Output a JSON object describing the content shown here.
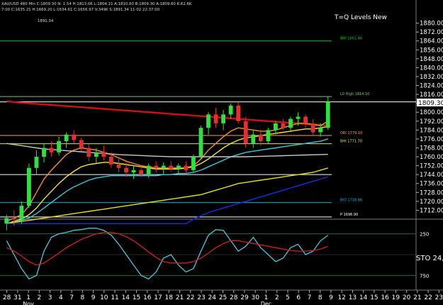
{
  "header": {
    "line1": "XAU/USD 480 Min  C:1809.30  N: 1.54  H:1813.06  L:1804.21  A:1810.60  B:1809.30  A:1809.60  K:62.6K",
    "line2": "7:00  C:1635.21  H:1669.20  L:1634.61  C:1656.97  V:349K  S:1891.34  11-02 22:37:00",
    "prior_high": "1891.34"
  },
  "chart_data": [
    {
      "type": "line",
      "title": "T=Q Levels New",
      "title_suffix": "STO",
      "price_axis": {
        "ylim": [
          1704,
          1888
        ],
        "ticks": [
          1712,
          1720,
          1728,
          1736,
          1744,
          1752,
          1760,
          1768,
          1776,
          1784,
          1792,
          1800,
          1808,
          1816,
          1824,
          1832,
          1840,
          1848,
          1856,
          1864,
          1872,
          1880
        ],
        "tick_labels": [
          "1712.00",
          "1720.00",
          "1728.00",
          "1736.00",
          "1744.00",
          "1752.00",
          "1760.00",
          "1768.00",
          "1776.00",
          "1784.00",
          "1792.00",
          "1800.00",
          "",
          "1816.00",
          "1824.00",
          "1832.00",
          "1840.00",
          "1848.00",
          "1856.00",
          "1864.00",
          "1872.00",
          "1880.00"
        ],
        "last_price": 1809.3,
        "last_price_label": "1809.30"
      },
      "x_axis": {
        "tick_labels": [
          "28",
          "31",
          "1",
          "2",
          "3",
          "4",
          "7",
          "8",
          "9",
          "10",
          "11",
          "14",
          "15",
          "16",
          "17",
          "18",
          "21",
          "22",
          "23",
          "24",
          "25",
          "28",
          "29",
          "30",
          "1",
          "2",
          "5",
          "6",
          "7",
          "8",
          "9",
          "12",
          "13",
          "14",
          "15",
          "16",
          "19",
          "20",
          "21",
          "22",
          "23"
        ],
        "month_labels": [
          {
            "label": "Nov",
            "after_tick": 2
          },
          {
            "label": "Dec",
            "after_tick": 24
          }
        ]
      },
      "levels": [
        {
          "label": "BHI 1861.44",
          "value": 1864,
          "color": "#00d000"
        },
        {
          "label": "L0 High 1814.10",
          "value": 1814.1,
          "color": "#80c080"
        },
        {
          "label": "",
          "value": 1809.3,
          "color": "#ffffff"
        },
        {
          "label": "ORI 1779.10",
          "value": 1779.1,
          "color": "#ffa040"
        },
        {
          "label": "BHI 1771.70",
          "value": 1771.7,
          "color": "#e0e060"
        },
        {
          "label": "",
          "value": 1744,
          "color": "#ffffff"
        },
        {
          "label": "BIO 1718.86",
          "value": 1718.9,
          "color": "#00b0d0"
        },
        {
          "label": "P 1696.90",
          "value": 1706,
          "color": "#ffffff"
        }
      ],
      "candles": [
        [
          1700,
          1708,
          1694,
          1705
        ],
        [
          1705,
          1712,
          1698,
          1704
        ],
        [
          1704,
          1720,
          1700,
          1716
        ],
        [
          1716,
          1754,
          1714,
          1750
        ],
        [
          1750,
          1766,
          1744,
          1760
        ],
        [
          1760,
          1772,
          1755,
          1768
        ],
        [
          1768,
          1774,
          1760,
          1764
        ],
        [
          1764,
          1778,
          1761,
          1774
        ],
        [
          1774,
          1782,
          1768,
          1780
        ],
        [
          1780,
          1784,
          1772,
          1775
        ],
        [
          1775,
          1777,
          1765,
          1768
        ],
        [
          1768,
          1772,
          1756,
          1760
        ],
        [
          1760,
          1768,
          1754,
          1764
        ],
        [
          1764,
          1770,
          1757,
          1760
        ],
        [
          1760,
          1764,
          1750,
          1753
        ],
        [
          1753,
          1760,
          1746,
          1750
        ],
        [
          1750,
          1755,
          1742,
          1746
        ],
        [
          1746,
          1752,
          1740,
          1748
        ],
        [
          1748,
          1752,
          1742,
          1744
        ],
        [
          1744,
          1754,
          1741,
          1752
        ],
        [
          1752,
          1756,
          1746,
          1750
        ],
        [
          1750,
          1755,
          1744,
          1752
        ],
        [
          1752,
          1756,
          1747,
          1749
        ],
        [
          1749,
          1754,
          1744,
          1752
        ],
        [
          1752,
          1756,
          1745,
          1748
        ],
        [
          1748,
          1762,
          1746,
          1760
        ],
        [
          1760,
          1788,
          1758,
          1786
        ],
        [
          1786,
          1800,
          1780,
          1798
        ],
        [
          1798,
          1804,
          1786,
          1790
        ],
        [
          1790,
          1802,
          1784,
          1798
        ],
        [
          1798,
          1808,
          1794,
          1806
        ],
        [
          1806,
          1809,
          1790,
          1792
        ],
        [
          1792,
          1796,
          1768,
          1772
        ],
        [
          1772,
          1784,
          1768,
          1780
        ],
        [
          1780,
          1784,
          1770,
          1774
        ],
        [
          1774,
          1786,
          1772,
          1784
        ],
        [
          1784,
          1792,
          1780,
          1790
        ],
        [
          1790,
          1794,
          1784,
          1786
        ],
        [
          1786,
          1796,
          1782,
          1794
        ],
        [
          1794,
          1800,
          1788,
          1796
        ],
        [
          1796,
          1798,
          1786,
          1790
        ],
        [
          1790,
          1794,
          1780,
          1782
        ],
        [
          1782,
          1790,
          1778,
          1786
        ],
        [
          1786,
          1814,
          1784,
          1809.3
        ]
      ],
      "ma_series": [
        {
          "color": "#d01010",
          "values": [
            1810,
            1809,
            1808.5,
            1808,
            1807.5,
            1807,
            1806.5,
            1806,
            1805.5,
            1805,
            1804.5,
            1804,
            1803.5,
            1803,
            1802.5,
            1802,
            1801.5,
            1801,
            1800.5,
            1800,
            1799.5,
            1799,
            1798.5,
            1798,
            1797.5,
            1797,
            1796.5,
            1796,
            1795.5,
            1795,
            1794.5,
            1794,
            1793.5,
            1793,
            1792.5,
            1792,
            1791.5,
            1791,
            1790.5,
            1790,
            1789.5,
            1789,
            1788.5,
            1788
          ]
        },
        {
          "color": "#ff8c2a",
          "values": [
            1702,
            1705,
            1708,
            1716,
            1728,
            1740,
            1748,
            1755,
            1762,
            1766,
            1768,
            1767,
            1766,
            1764,
            1762,
            1759,
            1756,
            1754,
            1752,
            1751,
            1750,
            1750,
            1750,
            1750,
            1750,
            1752,
            1758,
            1766,
            1772,
            1778,
            1783,
            1786,
            1785,
            1784,
            1783,
            1783,
            1784,
            1786,
            1788,
            1790,
            1790,
            1789,
            1788,
            1792
          ]
        },
        {
          "color": "#ffe030",
          "values": [
            1700,
            1702,
            1704,
            1708,
            1714,
            1722,
            1729,
            1736,
            1742,
            1747,
            1751,
            1753,
            1754,
            1755,
            1755,
            1754,
            1753,
            1752,
            1751,
            1750,
            1749,
            1749,
            1749,
            1749,
            1750,
            1751,
            1754,
            1758,
            1763,
            1768,
            1772,
            1775,
            1777,
            1778,
            1779,
            1780,
            1781,
            1782,
            1783,
            1784,
            1785,
            1785,
            1786,
            1787
          ]
        },
        {
          "color": "#30c8e0",
          "values": [
            1700,
            1701,
            1703,
            1705,
            1709,
            1714,
            1719,
            1724,
            1729,
            1733,
            1736,
            1739,
            1741,
            1742,
            1743,
            1743,
            1743,
            1743,
            1743,
            1743,
            1743,
            1744,
            1744,
            1745,
            1745,
            1746,
            1748,
            1751,
            1754,
            1757,
            1760,
            1762,
            1764,
            1765,
            1766,
            1767,
            1768,
            1769,
            1770,
            1771,
            1772,
            1773,
            1774,
            1776
          ]
        },
        {
          "color": "#c8c8c8",
          "values": [
            1772,
            1771,
            1770,
            1769,
            1768,
            1767,
            1766.5,
            1766,
            1765.5,
            1765,
            1764.5,
            1764,
            1763.5,
            1763,
            1762.5,
            1762,
            1761.7,
            1761.4,
            1761.1,
            1760.8,
            1760.5,
            1760.3,
            1760.1,
            1760,
            1760,
            1760,
            1760,
            1760,
            1760,
            1760,
            1760,
            1760,
            1760,
            1760.2,
            1760.4,
            1760.6,
            1760.8,
            1761,
            1761.2,
            1761.4,
            1761.6,
            1761.8,
            1762,
            1762.2
          ]
        },
        {
          "color": "#e8e000",
          "values": [
            1700,
            1701,
            1702,
            1703,
            1704,
            1705,
            1706,
            1707,
            1708,
            1709,
            1710,
            1711,
            1712,
            1713,
            1714,
            1715,
            1716,
            1717,
            1718,
            1719,
            1720,
            1721,
            1722,
            1723,
            1724,
            1725,
            1726,
            1728,
            1730,
            1732,
            1734,
            1736,
            1737,
            1738,
            1739,
            1740,
            1741,
            1742,
            1743,
            1744,
            1745,
            1746,
            1748,
            1750
          ]
        },
        {
          "color": "#1030e0",
          "values": [
            1700,
            1700,
            1700,
            1700,
            1700,
            1700,
            1700,
            1700,
            1700,
            1700,
            1700,
            1700,
            1700,
            1700,
            1700,
            1700,
            1700,
            1700,
            1700,
            1700,
            1700,
            1700,
            1700,
            1700,
            1700,
            1704,
            1707,
            1710,
            1712,
            1714,
            1716,
            1718,
            1720,
            1722,
            1724,
            1726,
            1728,
            1730,
            1732,
            1734,
            1736,
            1738,
            1740,
            1742
          ]
        }
      ]
    },
    {
      "type": "line",
      "title": "STO 24,",
      "ylim": [
        0,
        100
      ],
      "tick_labels": [
        {
          "label": "250",
          "value": 80
        },
        {
          "label": "750",
          "value": 20
        }
      ],
      "series": [
        {
          "color": "#40c8e0",
          "values": [
            70,
            50,
            30,
            15,
            20,
            55,
            75,
            80,
            82,
            85,
            86,
            88,
            88,
            85,
            78,
            65,
            50,
            35,
            20,
            15,
            25,
            45,
            50,
            35,
            25,
            30,
            55,
            78,
            86,
            85,
            70,
            55,
            62,
            75,
            60,
            50,
            40,
            45,
            60,
            65,
            50,
            55,
            70,
            78
          ]
        },
        {
          "color": "#d02020",
          "values": [
            60,
            55,
            48,
            40,
            35,
            38,
            45,
            52,
            60,
            66,
            72,
            76,
            80,
            82,
            82,
            80,
            76,
            70,
            62,
            54,
            46,
            40,
            38,
            38,
            38,
            40,
            45,
            52,
            60,
            66,
            70,
            70,
            68,
            66,
            64,
            62,
            60,
            58,
            56,
            55,
            55,
            56,
            58,
            62
          ]
        }
      ]
    }
  ]
}
